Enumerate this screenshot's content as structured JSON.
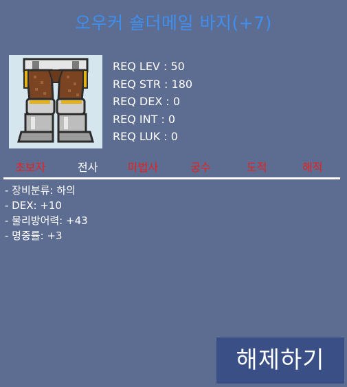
{
  "title": "오우커 숄더메일 바지(+7)",
  "item": {
    "icon": "armor-pants-icon"
  },
  "requirements": [
    "REQ LEV : 50",
    "REQ STR : 180",
    "REQ DEX : 0",
    "REQ INT : 0",
    "REQ LUK : 0"
  ],
  "jobs": [
    {
      "label": "초보자",
      "color": "#e8201e"
    },
    {
      "label": "전사",
      "color": "#ffffff"
    },
    {
      "label": "마법사",
      "color": "#e8201e"
    },
    {
      "label": "궁수",
      "color": "#e8201e"
    },
    {
      "label": "도적",
      "color": "#e8201e"
    },
    {
      "label": "해적",
      "color": "#e8201e"
    }
  ],
  "stats": [
    "- 장비분류: 하의",
    "- DEX: +10",
    "- 물리방어력: +43",
    "- 명중률: +3"
  ],
  "action_button": {
    "label": "해제하기"
  },
  "colors": {
    "background": "#5d6d91",
    "title": "#3f8ff0",
    "button": "#3a4f86",
    "job_disabled": "#e8201e",
    "job_enabled": "#ffffff"
  }
}
